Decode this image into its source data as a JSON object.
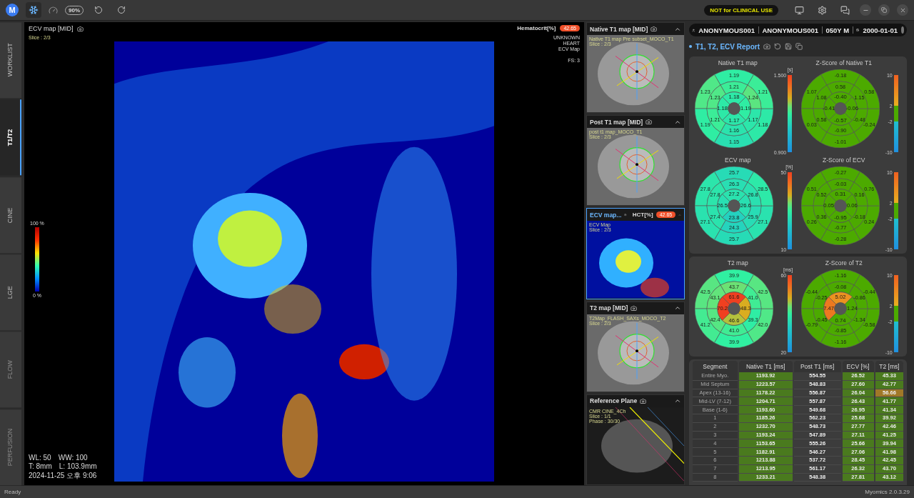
{
  "app": {
    "logo": "M",
    "zoom": "90%",
    "notice": "NOT for CLINICAL USE"
  },
  "nav_tabs": [
    {
      "label": "WORKLIST",
      "selected": false,
      "disabled": false
    },
    {
      "label": "T1/T2",
      "selected": true,
      "disabled": false
    },
    {
      "label": "CINE",
      "selected": false,
      "disabled": false
    },
    {
      "label": "LGE",
      "selected": false,
      "disabled": false
    },
    {
      "label": "FLOW",
      "selected": false,
      "disabled": true
    },
    {
      "label": "PERFUSION",
      "selected": false,
      "disabled": true
    }
  ],
  "viewer": {
    "title": "ECV map [MID]",
    "slice": "Slice : 2/3",
    "hct_label": "Hematocrit[%]",
    "hct_value": "42.65",
    "info": [
      "UNKNOWN",
      "HEART",
      "ECV Map"
    ],
    "fs": "FS: 3",
    "colorbar": {
      "max": "100 %",
      "min": "0 %"
    },
    "footer": [
      [
        "WL: 50",
        "WW: 100"
      ],
      [
        "T: 8mm",
        "L: 103.9mm"
      ],
      [
        "2024-11-25 오후 9:06"
      ]
    ]
  },
  "thumbnails": [
    {
      "kind": "map",
      "title": "Native T1 map [MID]",
      "selected": false,
      "overlay": [
        "Native T1 map Pre subset_MOCO_T1",
        "Slice : 2/3"
      ]
    },
    {
      "kind": "map",
      "title": "Post T1 map [MID]",
      "selected": false,
      "overlay": [
        "post t1 map_MOCO_T1",
        "Slice : 2/3"
      ]
    },
    {
      "kind": "ecv",
      "title": "ECV map...",
      "selected": true,
      "hct_label": "HCT[%]",
      "hct_value": "42.65",
      "overlay": [
        "ECV Map",
        "Slice : 2/3"
      ]
    },
    {
      "kind": "map",
      "title": "T2 map [MID]",
      "selected": false,
      "overlay": [
        "T2Map_FLASH_SAXs_MOCO_T2",
        "Slice : 2/3"
      ]
    },
    {
      "kind": "reference",
      "title": "Reference Plane",
      "selected": false,
      "overlay": [
        "CMR CINE_4Ch",
        "Slice : 1/1",
        "Phase : 30/30"
      ]
    }
  ],
  "patient": {
    "fields": [
      "ANONYMOUS001",
      "ANONYMOUS001",
      "050Y M"
    ],
    "birth_date": "2000-01-01"
  },
  "report": {
    "title": "T1, T2, ECV Report",
    "cards": [
      {
        "plots": [
          {
            "kind": "map",
            "title": "Native T1 map",
            "unit": "[s]",
            "ticks": [
              "1.500",
              "0.900"
            ],
            "basal": [
              "1.19",
              "1.23",
              "1.19",
              "1.15",
              "1.18",
              "1.21"
            ],
            "mid": [
              "1.21",
              "1.23",
              "1.21",
              "1.16",
              "1.17",
              "1.24"
            ],
            "apical": [
              "1.18",
              "1.18",
              "1.17",
              "1.19"
            ]
          },
          {
            "kind": "zscore",
            "title": "Z-Score of Native T1",
            "ticks": [
              "10",
              "2",
              "-2",
              "-10"
            ],
            "basal": [
              "-0.18",
              "1.07",
              "0.03",
              "-1.01",
              "-0.24",
              "0.58"
            ],
            "mid": [
              "0.58",
              "1.08",
              "0.58",
              "-0.90",
              "-0.48",
              "1.15"
            ],
            "apical": [
              "-0.40",
              "-0.41",
              "-0.57",
              "-0.06"
            ]
          },
          {
            "kind": "map",
            "title": "ECV map",
            "unit": "[%]",
            "ticks": [
              "50",
              "10"
            ],
            "basal": [
              "25.7",
              "27.8",
              "27.1",
              "25.7",
              "27.1",
              "28.5"
            ],
            "mid": [
              "26.3",
              "27.8",
              "27.4",
              "24.3",
              "25.9",
              "26.8"
            ],
            "apical": [
              "27.2",
              "26.5",
              "23.8",
              "26.6"
            ]
          },
          {
            "kind": "zscore",
            "title": "Z-Score of ECV",
            "ticks": [
              "10",
              "2",
              "-2",
              "-10"
            ],
            "basal": [
              "-0.27",
              "0.51",
              "0.26",
              "-0.28",
              "0.24",
              "0.76"
            ],
            "mid": [
              "-0.03",
              "0.52",
              "0.36",
              "-0.77",
              "-0.18",
              "0.16"
            ],
            "apical": [
              "0.31",
              "0.05",
              "-0.95",
              "0.06"
            ]
          }
        ]
      },
      {
        "plots": [
          {
            "kind": "map",
            "title": "T2 map",
            "unit": "[ms]",
            "ticks": [
              "60",
              "20"
            ],
            "basal": [
              "39.9",
              "42.5",
              "41.2",
              "39.9",
              "42.0",
              "42.5"
            ],
            "mid": [
              "43.7",
              "43.1",
              "42.4",
              "41.0",
              "39.3",
              "41.0"
            ],
            "apical": [
              "61.6",
              "70.2",
              "46.6",
              "48.3"
            ]
          },
          {
            "kind": "zscore",
            "title": "Z-Score of T2",
            "ticks": [
              "10",
              "2",
              "-2",
              "-10"
            ],
            "basal": [
              "-1.16",
              "-0.44",
              "-0.79",
              "-1.16",
              "-0.58",
              "-0.44"
            ],
            "mid": [
              "-0.08",
              "-0.25",
              "-0.45",
              "-0.85",
              "-1.34",
              "-0.86"
            ],
            "apical": [
              "5.02",
              "7.47",
              "0.74",
              "1.24"
            ]
          }
        ]
      }
    ],
    "table": {
      "columns": [
        "Segment",
        "Native T1 [ms]",
        "Post T1 [ms]",
        "ECV [%]",
        "T2 [ms]"
      ],
      "rows": [
        {
          "cells": [
            {
              "text": "Entire Myo.",
              "shaded": false,
              "high": false
            },
            {
              "text": "1193.92",
              "shaded": true,
              "high": false
            },
            {
              "text": "554.55",
              "shaded": false,
              "high": false
            },
            {
              "text": "26.52",
              "shaded": true,
              "high": false
            },
            {
              "text": "45.33",
              "shaded": true,
              "high": false
            }
          ]
        },
        {
          "cells": [
            {
              "text": "Mid Septum",
              "shaded": false,
              "high": false
            },
            {
              "text": "1223.57",
              "shaded": true,
              "high": false
            },
            {
              "text": "548.83",
              "shaded": false,
              "high": false
            },
            {
              "text": "27.60",
              "shaded": true,
              "high": false
            },
            {
              "text": "42.77",
              "shaded": true,
              "high": false
            }
          ]
        },
        {
          "cells": [
            {
              "text": "Apex (13-16)",
              "shaded": false,
              "high": false
            },
            {
              "text": "1178.22",
              "shaded": true,
              "high": false
            },
            {
              "text": "556.87",
              "shaded": false,
              "high": false
            },
            {
              "text": "26.04",
              "shaded": true,
              "high": false
            },
            {
              "text": "56.66",
              "shaded": true,
              "high": true
            }
          ]
        },
        {
          "cells": [
            {
              "text": "Mid-LV (7-12)",
              "shaded": false,
              "high": false
            },
            {
              "text": "1204.71",
              "shaded": true,
              "high": false
            },
            {
              "text": "557.87",
              "shaded": false,
              "high": false
            },
            {
              "text": "26.43",
              "shaded": true,
              "high": false
            },
            {
              "text": "41.77",
              "shaded": true,
              "high": false
            }
          ]
        },
        {
          "cells": [
            {
              "text": "Base (1-6)",
              "shaded": false,
              "high": false
            },
            {
              "text": "1193.60",
              "shaded": true,
              "high": false
            },
            {
              "text": "549.68",
              "shaded": false,
              "high": false
            },
            {
              "text": "26.95",
              "shaded": true,
              "high": false
            },
            {
              "text": "41.34",
              "shaded": true,
              "high": false
            }
          ]
        },
        {
          "cells": [
            {
              "text": "1",
              "shaded": false,
              "high": false
            },
            {
              "text": "1185.26",
              "shaded": true,
              "high": false
            },
            {
              "text": "562.23",
              "shaded": false,
              "high": false
            },
            {
              "text": "25.68",
              "shaded": true,
              "high": false
            },
            {
              "text": "39.92",
              "shaded": true,
              "high": false
            }
          ]
        },
        {
          "cells": [
            {
              "text": "2",
              "shaded": false,
              "high": false
            },
            {
              "text": "1232.70",
              "shaded": true,
              "high": false
            },
            {
              "text": "548.73",
              "shaded": false,
              "high": false
            },
            {
              "text": "27.77",
              "shaded": true,
              "high": false
            },
            {
              "text": "42.46",
              "shaded": true,
              "high": false
            }
          ]
        },
        {
          "cells": [
            {
              "text": "3",
              "shaded": false,
              "high": false
            },
            {
              "text": "1193.24",
              "shaded": true,
              "high": false
            },
            {
              "text": "547.89",
              "shaded": false,
              "high": false
            },
            {
              "text": "27.11",
              "shaded": true,
              "high": false
            },
            {
              "text": "41.25",
              "shaded": true,
              "high": false
            }
          ]
        },
        {
          "cells": [
            {
              "text": "4",
              "shaded": false,
              "high": false
            },
            {
              "text": "1153.65",
              "shaded": true,
              "high": false
            },
            {
              "text": "555.26",
              "shaded": false,
              "high": false
            },
            {
              "text": "25.66",
              "shaded": true,
              "high": false
            },
            {
              "text": "39.94",
              "shaded": true,
              "high": false
            }
          ]
        },
        {
          "cells": [
            {
              "text": "5",
              "shaded": false,
              "high": false
            },
            {
              "text": "1182.91",
              "shaded": true,
              "high": false
            },
            {
              "text": "546.27",
              "shaded": false,
              "high": false
            },
            {
              "text": "27.06",
              "shaded": true,
              "high": false
            },
            {
              "text": "41.98",
              "shaded": true,
              "high": false
            }
          ]
        },
        {
          "cells": [
            {
              "text": "6",
              "shaded": false,
              "high": false
            },
            {
              "text": "1213.88",
              "shaded": true,
              "high": false
            },
            {
              "text": "537.72",
              "shaded": false,
              "high": false
            },
            {
              "text": "28.45",
              "shaded": true,
              "high": false
            },
            {
              "text": "42.45",
              "shaded": true,
              "high": false
            }
          ]
        },
        {
          "cells": [
            {
              "text": "7",
              "shaded": false,
              "high": false
            },
            {
              "text": "1213.95",
              "shaded": true,
              "high": false
            },
            {
              "text": "561.17",
              "shaded": false,
              "high": false
            },
            {
              "text": "26.32",
              "shaded": true,
              "high": false
            },
            {
              "text": "43.70",
              "shaded": true,
              "high": false
            }
          ]
        },
        {
          "cells": [
            {
              "text": "8",
              "shaded": false,
              "high": false
            },
            {
              "text": "1233.21",
              "shaded": true,
              "high": false
            },
            {
              "text": "548.38",
              "shaded": false,
              "high": false
            },
            {
              "text": "27.81",
              "shaded": true,
              "high": false
            },
            {
              "text": "43.12",
              "shaded": true,
              "high": false
            }
          ]
        }
      ]
    }
  },
  "status_bar": {
    "left": "Ready",
    "right": "Myomics 2.0.3.29"
  }
}
